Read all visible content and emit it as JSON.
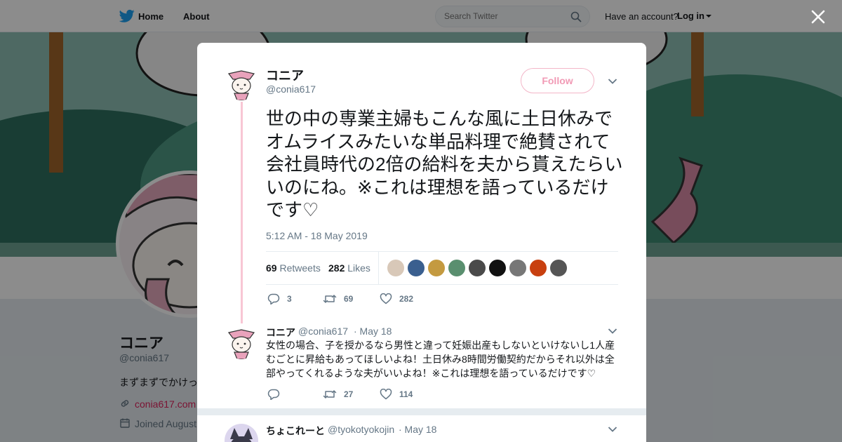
{
  "topnav": {
    "home": "Home",
    "about": "About",
    "search_placeholder": "Search Twitter",
    "have_account": "Have an account?",
    "login": "Log in"
  },
  "profile": {
    "name": "コニア",
    "handle": "@conia617",
    "bio": "まずまずでかけっ",
    "link": "conia617.com",
    "joined": "Joined August"
  },
  "tweet": {
    "name": "コニア",
    "handle": "@conia617",
    "follow_label": "Follow",
    "text": "世の中の専業主婦もこんな風に土日休みでオムライスみたいな単品料理で絶賛されて会社員時代の2倍の給料を夫から貰えたらいいのにね。※これは理想を語っているだけです♡",
    "time": "5:12 AM - 18 May 2019",
    "retweets_count": "69",
    "retweets_label": "Retweets",
    "likes_count": "282",
    "likes_label": "Likes",
    "actions": {
      "replies": "3",
      "retweets": "69",
      "likes": "282"
    },
    "likers": [
      "#d8c8b8",
      "#3a5f8f",
      "#c49a40",
      "#5a8f6f",
      "#4a4a4a",
      "#111111",
      "#777777",
      "#c84010",
      "#555555"
    ]
  },
  "reply1": {
    "name": "コニア",
    "handle": "@conia617",
    "date": "· May 18",
    "text": "女性の場合、子を授かるなら男性と違って妊娠出産もしないといけないし1人産むごとに昇給もあってほしいよね！土日休み8時間労働契約だからそれ以外は全部やってくれるような夫がいいよね！※これは理想を語っているだけです♡",
    "actions": {
      "replies": "",
      "retweets": "27",
      "likes": "114"
    }
  },
  "reply2": {
    "name": "ちょこれーと",
    "handle": "@tyokotyokojin",
    "date": "· May 18"
  },
  "colors": {
    "accent_pink": "#e0245e",
    "twitter_blue": "#1da1f2",
    "thread_line": "#f8c6d4"
  }
}
